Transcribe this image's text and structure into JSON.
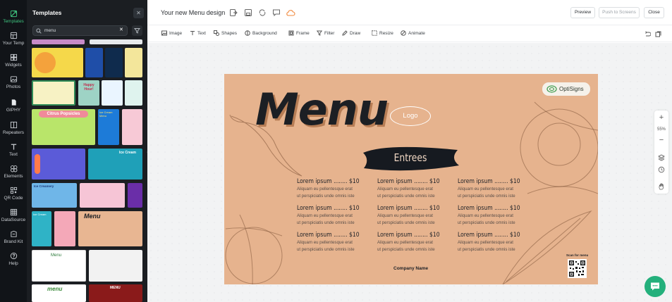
{
  "rail": {
    "items": [
      {
        "label": "Templates",
        "icon": "templates-icon",
        "active": true
      },
      {
        "label": "Your Temp",
        "icon": "your-templates-icon"
      },
      {
        "label": "Widgets",
        "icon": "widgets-icon"
      },
      {
        "label": "Photos",
        "icon": "photos-icon"
      },
      {
        "label": "GIPHY",
        "icon": "giphy-icon"
      },
      {
        "label": "Repeaters",
        "icon": "repeaters-icon"
      },
      {
        "label": "Text",
        "icon": "text-icon"
      },
      {
        "label": "Elements",
        "icon": "elements-icon"
      },
      {
        "label": "QR Code",
        "icon": "qr-code-icon"
      },
      {
        "label": "DataSource",
        "icon": "datasource-icon"
      },
      {
        "label": "Brand Kit",
        "icon": "brand-kit-icon"
      },
      {
        "label": "Help",
        "icon": "help-icon"
      }
    ]
  },
  "panel": {
    "title": "Templates",
    "search_value": "menu",
    "thumbnails": [
      {
        "label": "Citrus Popsicles"
      },
      {
        "label": "Ice Cream"
      },
      {
        "label": "Ice Cream"
      },
      {
        "label": "Ice Creamery"
      },
      {
        "label": "Menu"
      },
      {
        "label": "Menu"
      },
      {
        "label": "menu"
      },
      {
        "label": "MENU"
      },
      {
        "label": "Happy Hour!"
      },
      {
        "label": "Ice Cream Menu"
      }
    ]
  },
  "header": {
    "doc_title": "Your new Menu design",
    "preview": "Preview",
    "push": "Push to Screens",
    "close": "Close"
  },
  "toolbar": {
    "image": "Image",
    "text": "Text",
    "shapes": "Shapes",
    "background": "Background",
    "frame": "Frame",
    "filter": "Filter",
    "draw": "Draw",
    "resize": "Resize",
    "animate": "Animate"
  },
  "zoom": {
    "level": "55%"
  },
  "design": {
    "title": "Menu",
    "logo": "Logo",
    "brand": "OptiSigns",
    "section": "Entrees",
    "items": [
      {
        "title": "Lorem ipsum ........ $10",
        "line1": "Aliquam eu pellentesque erat",
        "line2": "ut perspiciatis unde omnis iste"
      },
      {
        "title": "Lorem ipsum ........ $10",
        "line1": "Aliquam eu pellentesque erat",
        "line2": "ut perspiciatis unde omnis iste"
      },
      {
        "title": "Lorem ipsum ........ $10",
        "line1": "Aliquam eu pellentesque erat",
        "line2": "ut perspiciatis unde omnis iste"
      },
      {
        "title": "Lorem ipsum ........ $10",
        "line1": "Aliquam eu pellentesque erat",
        "line2": "ut perspiciatis unde omnis iste"
      },
      {
        "title": "Lorem ipsum ........ $10",
        "line1": "Aliquam eu pellentesque erat",
        "line2": "ut perspiciatis unde omnis iste"
      },
      {
        "title": "Lorem ipsum ........ $10",
        "line1": "Aliquam eu pellentesque erat",
        "line2": "ut perspiciatis unde omnis iste"
      },
      {
        "title": "Lorem ipsum ........ $10",
        "line1": "Aliquam eu pellentesque erat",
        "line2": "ut perspiciatis unde omnis iste"
      },
      {
        "title": "Lorem ipsum ........ $10",
        "line1": "Aliquam eu pellentesque erat",
        "line2": "ut perspiciatis unde omnis iste"
      },
      {
        "title": "Lorem ipsum ........ $10",
        "line1": "Aliquam eu pellentesque erat",
        "line2": "ut perspiciatis unde omnis iste"
      }
    ],
    "company": "Company Name",
    "scan": "Scan for menu"
  },
  "colors": {
    "accent": "#3ec27e",
    "design_bg": "#e6b38e",
    "chat": "#24b07c"
  }
}
